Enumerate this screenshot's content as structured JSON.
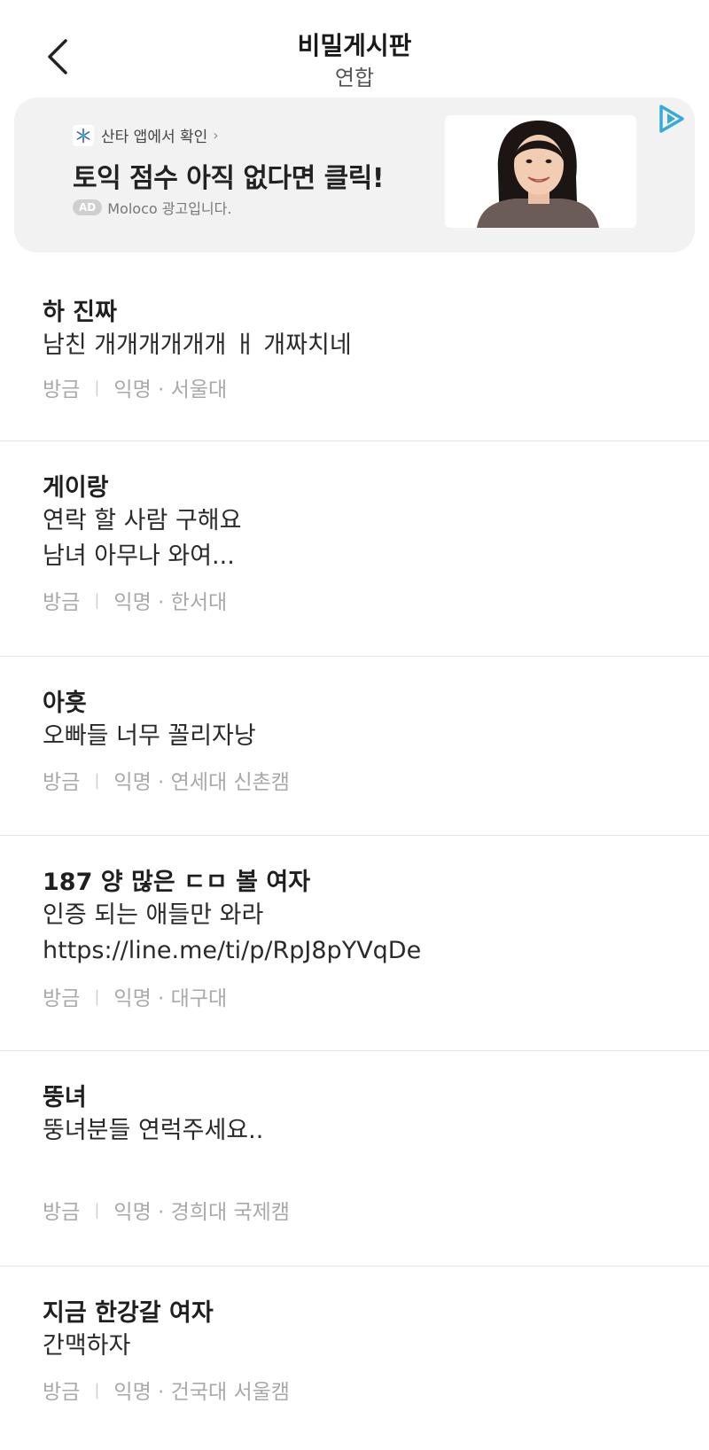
{
  "header": {
    "title": "비밀게시판",
    "subtitle": "연합"
  },
  "ad": {
    "source": "산타 앱에서 확인",
    "source_icon": "santa-snowflake-icon",
    "headline": "토익 점수 아직 없다면 클릭!",
    "badge": "AD",
    "advertiser": "Moloco 광고입니다."
  },
  "posts": [
    {
      "title": "하 진짜",
      "body": [
        "남친 개개개개개개 ㅐ 개짜치네"
      ],
      "time": "방금",
      "author": "익명 · 서울대"
    },
    {
      "title": "게이랑",
      "body": [
        "연락 할 사람 구해요",
        "남녀 아무나 와여..."
      ],
      "time": "방금",
      "author": "익명 · 한서대"
    },
    {
      "title": "아흣",
      "body": [
        "오빠들 너무 꼴리자낭"
      ],
      "time": "방금",
      "author": "익명 · 연세대 신촌캠"
    },
    {
      "title": "187 양 많은 ㄷㅁ 볼 여자",
      "body": [
        "인증 되는 애들만 와라",
        "https://line.me/ti/p/RpJ8pYVqDe"
      ],
      "time": "방금",
      "author": "익명 · 대구대"
    },
    {
      "title": "뚱녀",
      "body": [
        "뚱녀분들 연럭주세요.."
      ],
      "time": "방금",
      "author": "익명 · 경희대 국제캠"
    },
    {
      "title": "지금 한강갈 여자",
      "body": [
        "간맥하자"
      ],
      "time": "방금",
      "author": "익명 · 건국대 서울캠"
    }
  ]
}
